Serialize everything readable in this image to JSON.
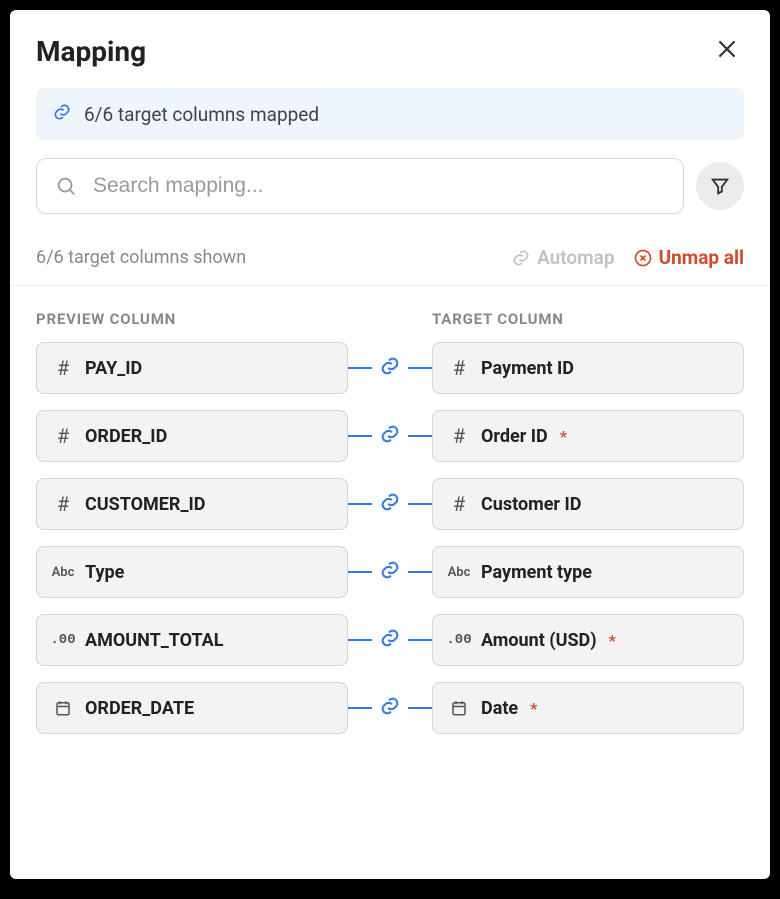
{
  "title": "Mapping",
  "banner": {
    "text": "6/6 target columns mapped"
  },
  "search": {
    "placeholder": "Search mapping..."
  },
  "shown_text": "6/6 target columns shown",
  "automap_label": "Automap",
  "unmap_label": "Unmap all",
  "header_preview": "PREVIEW COLUMN",
  "header_target": "TARGET COLUMN",
  "type_icons": {
    "number": "#",
    "text": "Abc",
    "decimal": ".00"
  },
  "mappings": [
    {
      "preview": {
        "type": "number",
        "name": "PAY_ID"
      },
      "target": {
        "type": "number",
        "name": "Payment ID",
        "required": false
      }
    },
    {
      "preview": {
        "type": "number",
        "name": "ORDER_ID"
      },
      "target": {
        "type": "number",
        "name": "Order ID",
        "required": true
      }
    },
    {
      "preview": {
        "type": "number",
        "name": "CUSTOMER_ID"
      },
      "target": {
        "type": "number",
        "name": "Customer ID",
        "required": false
      }
    },
    {
      "preview": {
        "type": "text",
        "name": "Type"
      },
      "target": {
        "type": "text",
        "name": "Payment type",
        "required": false
      }
    },
    {
      "preview": {
        "type": "decimal",
        "name": "AMOUNT_TOTAL"
      },
      "target": {
        "type": "decimal",
        "name": "Amount (USD)",
        "required": true
      }
    },
    {
      "preview": {
        "type": "date",
        "name": "ORDER_DATE"
      },
      "target": {
        "type": "date",
        "name": "Date",
        "required": true
      }
    }
  ]
}
